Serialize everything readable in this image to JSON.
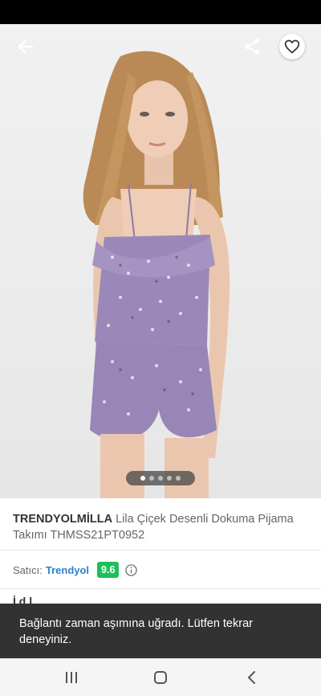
{
  "product": {
    "brand": "TRENDYOLMİLLA",
    "name": "Lila Çiçek Desenli Dokuma Pijama Takımı THMSS21PT0952"
  },
  "gallery": {
    "image_description": "model wearing lilac floral camisole and shorts pajama set",
    "dot_count": 5,
    "active_dot": 1
  },
  "seller": {
    "label": "Satıcı:",
    "name": "Trendyol",
    "score": "9.6"
  },
  "partial_text": "İ        d         l",
  "snackbar": {
    "message": "Bağlantı zaman aşımına uğradı. Lütfen tekrar deneyiniz."
  },
  "icons": {
    "back": "arrow-left-icon",
    "share": "share-icon",
    "favorite": "heart-icon",
    "info": "info-icon",
    "nav_recents": "recents-icon",
    "nav_home": "home-icon",
    "nav_back": "nav-back-icon"
  },
  "colors": {
    "seller_link": "#2d7fd3",
    "score_badge": "#1dbf5a",
    "snackbar_bg": "#323232"
  }
}
